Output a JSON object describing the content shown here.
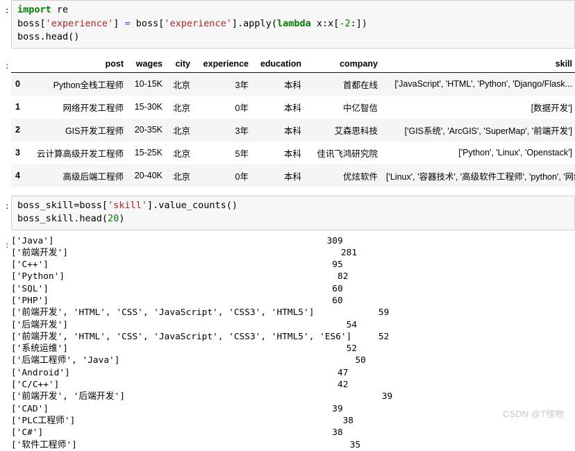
{
  "notebook": {
    "in_prompt": ":",
    "out_prompt": ":",
    "watermark": "CSDN @T怪物"
  },
  "cell1": {
    "name": "code-cell-1",
    "lines": [
      [
        {
          "t": "import",
          "c": "kw"
        },
        {
          "t": " re",
          "c": "plain"
        }
      ],
      [
        {
          "t": "boss[",
          "c": "plain"
        },
        {
          "t": "'experience'",
          "c": "str"
        },
        {
          "t": "] ",
          "c": "plain"
        },
        {
          "t": "=",
          "c": "op"
        },
        {
          "t": " boss[",
          "c": "plain"
        },
        {
          "t": "'experience'",
          "c": "str"
        },
        {
          "t": "].apply(",
          "c": "plain"
        },
        {
          "t": "lambda",
          "c": "kw"
        },
        {
          "t": " x:x[",
          "c": "plain"
        },
        {
          "t": "-2",
          "c": "num"
        },
        {
          "t": ":])",
          "c": "plain"
        }
      ],
      [
        {
          "t": "boss.head()",
          "c": "plain"
        }
      ]
    ]
  },
  "dataframe": {
    "name": "boss-head-dataframe",
    "index_header": "",
    "columns": [
      "post",
      "wages",
      "city",
      "experience",
      "education",
      "company",
      "skill"
    ],
    "rows": [
      {
        "index": "0",
        "post": "Python全栈工程师",
        "wages": "10-15K",
        "city": "北京",
        "experience": "3年",
        "education": "本科",
        "company": "首都在线",
        "skill": "['JavaScript', 'HTML', 'Python', 'Django/Flask..."
      },
      {
        "index": "1",
        "post": "网络开发工程师",
        "wages": "15-30K",
        "city": "北京",
        "experience": "0年",
        "education": "本科",
        "company": "中亿智信",
        "skill": "[数据开发']"
      },
      {
        "index": "2",
        "post": "GIS开发工程师",
        "wages": "20-35K",
        "city": "北京",
        "experience": "3年",
        "education": "本科",
        "company": "艾森思科技",
        "skill": "['GIS系统', 'ArcGIS', 'SuperMap', '前端开发']"
      },
      {
        "index": "3",
        "post": "云计算高级开发工程师",
        "wages": "15-25K",
        "city": "北京",
        "experience": "5年",
        "education": "本科",
        "company": "佳讯飞鸿研究院",
        "skill": "['Python', 'Linux', 'Openstack']"
      },
      {
        "index": "4",
        "post": "高级后端工程师",
        "wages": "20-40K",
        "city": "北京",
        "experience": "0年",
        "education": "本科",
        "company": "优炫软件",
        "skill": "['Linux', '容器技术', '高级软件工程师', 'python', '网络安全']"
      }
    ]
  },
  "cell2": {
    "name": "code-cell-2",
    "lines": [
      [
        {
          "t": "boss_skill",
          "c": "plain"
        },
        {
          "t": "=",
          "c": "plain"
        },
        {
          "t": "boss[",
          "c": "plain"
        },
        {
          "t": "'skill'",
          "c": "str"
        },
        {
          "t": "].value_counts()",
          "c": "plain"
        }
      ],
      [
        {
          "t": "boss_skill.head(",
          "c": "plain"
        },
        {
          "t": "20",
          "c": "num"
        },
        {
          "t": ")",
          "c": "plain"
        }
      ]
    ]
  },
  "series_output": {
    "name": "boss-skill-value-counts",
    "entries": [
      {
        "label": "['Java']",
        "value": "309",
        "pad": 51
      },
      {
        "label": "['前端开发']",
        "value": "281",
        "pad": 51
      },
      {
        "label": "['C++']",
        "value": "95",
        "pad": 53
      },
      {
        "label": "['Python']",
        "value": "82",
        "pad": 51
      },
      {
        "label": "['SQL']",
        "value": "60",
        "pad": 53
      },
      {
        "label": "['PHP']",
        "value": "60",
        "pad": 53
      },
      {
        "label": "['前端开发', 'HTML', 'CSS', 'JavaScript', 'CSS3', 'HTML5']",
        "value": "59",
        "pad": 12
      },
      {
        "label": "['后端开发']",
        "value": "54",
        "pad": 52
      },
      {
        "label": "['前端开发', 'HTML', 'CSS', 'JavaScript', 'CSS3', 'HTML5', 'ES6']",
        "value": "52",
        "pad": 5
      },
      {
        "label": "['系统运维']",
        "value": "52",
        "pad": 52
      },
      {
        "label": "['后端工程师', 'Java']",
        "value": "50",
        "pad": 44
      },
      {
        "label": "['Android']",
        "value": "47",
        "pad": 50
      },
      {
        "label": "['C/C++']",
        "value": "42",
        "pad": 52
      },
      {
        "label": "['前端开发', '后端开发']",
        "value": "39",
        "pad": 48
      },
      {
        "label": "['CAD']",
        "value": "39",
        "pad": 53
      },
      {
        "label": "['PLC工程师']",
        "value": "38",
        "pad": 50
      },
      {
        "label": "['C#']",
        "value": "38",
        "pad": 54
      },
      {
        "label": "['软件工程师']",
        "value": "35",
        "pad": 51
      }
    ]
  }
}
